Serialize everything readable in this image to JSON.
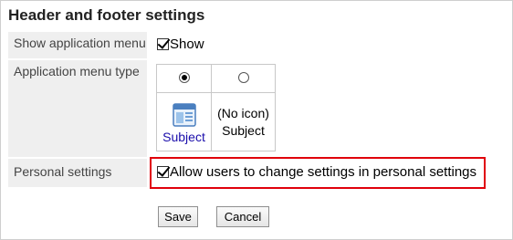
{
  "title": "Header and footer settings",
  "rows": {
    "show_app_menu": {
      "label": "Show application menu",
      "option": "Show",
      "checked": true
    },
    "app_menu_type": {
      "label": "Application menu type",
      "options": [
        {
          "icon": "app-window-icon",
          "caption": "Subject",
          "selected": true
        },
        {
          "icon_text": "(No icon)",
          "caption": "Subject",
          "selected": false
        }
      ]
    },
    "personal_settings": {
      "label": "Personal settings",
      "option": "Allow users to change settings in personal settings",
      "checked": true
    }
  },
  "buttons": {
    "save": "Save",
    "cancel": "Cancel"
  },
  "colors": {
    "highlight": "#e0000b",
    "link": "#1a0dab"
  }
}
